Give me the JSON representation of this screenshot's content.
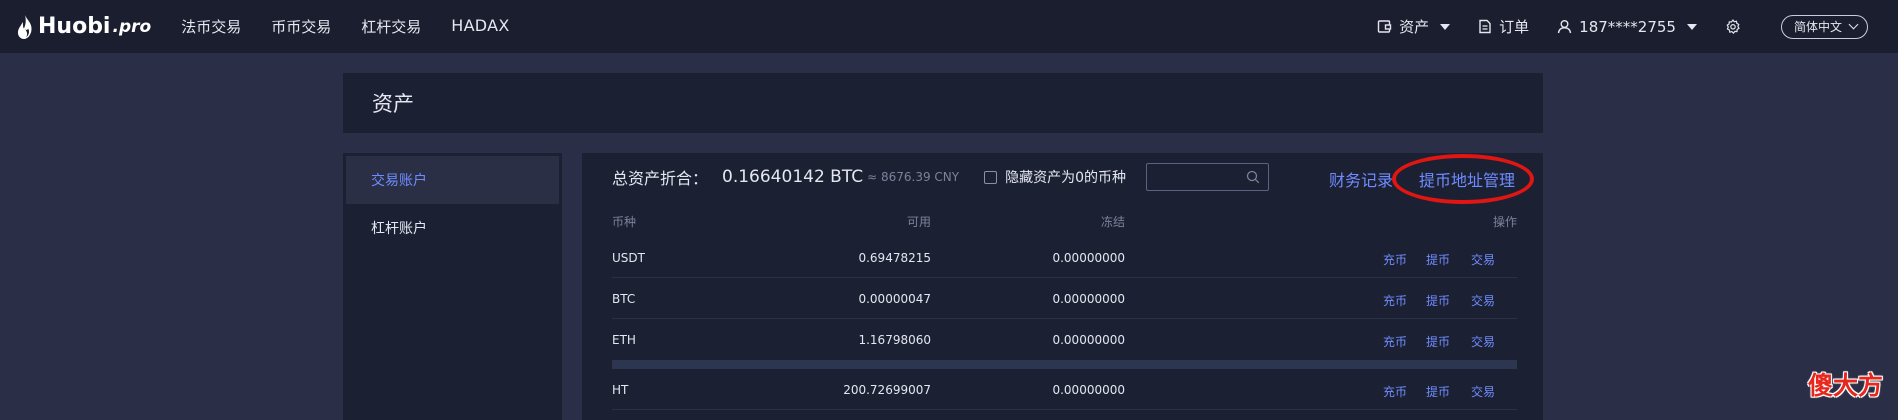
{
  "brand": {
    "name": "Huobi",
    "suffix": ".pro"
  },
  "nav": {
    "items": [
      {
        "label": "法币交易"
      },
      {
        "label": "币币交易"
      },
      {
        "label": "杠杆交易"
      },
      {
        "label": "HADAX"
      }
    ]
  },
  "user_menu": {
    "assets_label": "资产",
    "orders_label": "订单",
    "account_label": "187****2755",
    "language_label": "简体中文"
  },
  "page": {
    "title": "资产"
  },
  "sidebar": {
    "items": [
      {
        "label": "交易账户",
        "active": true
      },
      {
        "label": "杠杆账户",
        "active": false
      }
    ]
  },
  "summary": {
    "label": "总资产折合：",
    "btc": "0.16640142 BTC",
    "cny": "≈ 8676.39 CNY",
    "hide_zero_label": "隐藏资产为0的币种",
    "search_value": "",
    "finance_link": "财务记录",
    "address_link": "提币地址管理"
  },
  "table": {
    "columns": {
      "coin": "币种",
      "available": "可用",
      "frozen": "冻结",
      "actions": "操作"
    },
    "rows": [
      {
        "coin": "USDT",
        "available": "0.69478215",
        "frozen": "0.00000000"
      },
      {
        "coin": "BTC",
        "available": "0.00000047",
        "frozen": "0.00000000"
      },
      {
        "coin": "ETH",
        "available": "1.16798060",
        "frozen": "0.00000000"
      },
      {
        "coin": "HT",
        "available": "200.72699007",
        "frozen": "0.00000000"
      }
    ],
    "actions": {
      "deposit": "充币",
      "withdraw": "提币",
      "trade": "交易"
    }
  },
  "watermark": {
    "text": "傻大方"
  },
  "colors": {
    "accent": "#6f8cff",
    "highlight_ring": "#e01612",
    "topbar": "#1a1e2e",
    "panel": "#1c2033",
    "background": "#2a2f47"
  }
}
